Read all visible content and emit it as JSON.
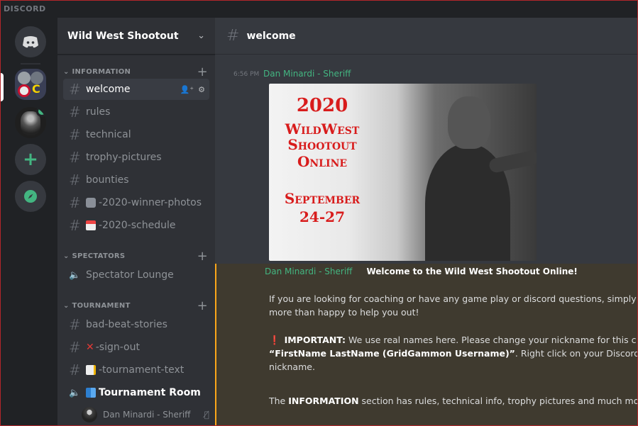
{
  "app": {
    "brand": "DISCORD"
  },
  "guild": {
    "name": "Wild West Shootout"
  },
  "categories": {
    "information": "INFORMATION",
    "spectators": "SPECTATORS",
    "tournament": "TOURNAMENT"
  },
  "channels": {
    "information": [
      "welcome",
      "rules",
      "technical",
      "trophy-pictures",
      "bounties",
      "-2020-winner-photos",
      "-2020-schedule"
    ],
    "spectators": [
      "Spectator Lounge"
    ],
    "tournament": [
      "bad-beat-stories",
      "-sign-out",
      "-tournament-text",
      "Tournament Room"
    ]
  },
  "voice_user": "Dan Minardi - Sheriff",
  "header": {
    "channel": "welcome"
  },
  "messages": {
    "first": {
      "timestamp": "6:56 PM",
      "author": "Dan Minardi - Sheriff",
      "poster": {
        "year": "2020",
        "line1": "WildWest",
        "line2": "Shootout",
        "line3": "Online",
        "line4": "September",
        "line5": "24-27"
      }
    },
    "second": {
      "author": "Dan Minardi - Sheriff",
      "title": "Welcome to the Wild West Shootout Online!",
      "p1a": "If you are looking for coaching or have any game play or discord questions, simply a",
      "p1b": "more than happy to help you out!",
      "p2_label": "IMPORTANT:",
      "p2a": " We use real names here. Please change your nickname for this c",
      "p2b_bold": "“FirstName LastName (GridGammon Username)”",
      "p2b": ". Right click on your Discord use",
      "p2c": "nickname.",
      "p3_pre": "The ",
      "p3_bold": "INFORMATION",
      "p3_post": " section has rules, technical info, trophy pictures and much mo"
    }
  },
  "colors": {
    "accent_green": "#43b581",
    "highlight": "#faa61a",
    "poster_red": "#d81c1c"
  }
}
